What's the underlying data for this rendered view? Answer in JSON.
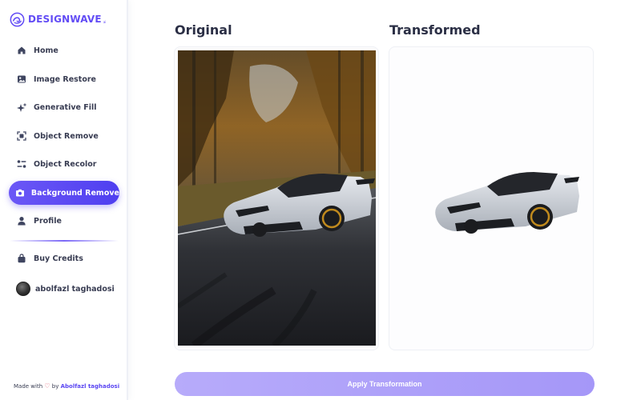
{
  "brand": {
    "name": "DESIGNWAVE",
    "mark": "ai",
    "accent": "#624cf5"
  },
  "sidebar": {
    "items": [
      {
        "label": "Home",
        "icon": "home-icon",
        "active": false
      },
      {
        "label": "Image Restore",
        "icon": "image-icon",
        "active": false
      },
      {
        "label": "Generative Fill",
        "icon": "sparkles-icon",
        "active": false
      },
      {
        "label": "Object Remove",
        "icon": "scan-icon",
        "active": false
      },
      {
        "label": "Object Recolor",
        "icon": "sliders-icon",
        "active": false
      },
      {
        "label": "Background Remove",
        "icon": "camera-icon",
        "active": true
      },
      {
        "label": "Profile",
        "icon": "user-icon",
        "active": false
      }
    ],
    "buy_credits": {
      "label": "Buy Credits",
      "icon": "bag-icon"
    },
    "user": {
      "name": "abolfazl taghadosi"
    }
  },
  "footer": {
    "made_with": "Made with",
    "by": "by",
    "author": "Abolfazl taghadosi",
    "heart_color": "#e0566a"
  },
  "main": {
    "original_title": "Original",
    "transformed_title": "Transformed",
    "apply_label": "Apply Transformation"
  }
}
